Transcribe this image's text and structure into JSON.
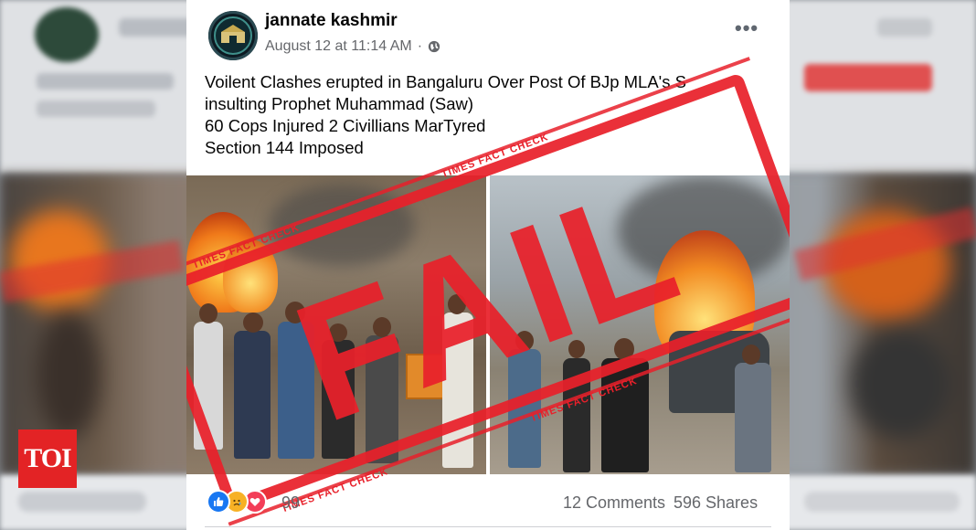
{
  "post": {
    "author": "jannate kashmir",
    "timestamp": "August 12 at 11:14 AM",
    "separator": "·",
    "more_label": "•••",
    "text_lines": [
      "Voilent Clashes erupted in Bangaluru Over Post Of BJp MLA's S",
      "insulting Prophet Muhammad (Saw)",
      "60 Cops Injured 2 Civillians MarTyred",
      "Section 144 Imposed"
    ]
  },
  "stamp": {
    "big_word": "FAIL",
    "band_text": "TIMES FACT CHECK",
    "color": "#e8202a"
  },
  "engagement": {
    "reaction_icons": [
      "like-icon",
      "sad-icon",
      "love-icon"
    ],
    "reaction_count": "99",
    "comments": "12 Comments",
    "shares": "596 Shares"
  },
  "branding": {
    "logo_text": "TOI",
    "logo_color": "#e32325"
  },
  "colors": {
    "facebook_blue": "#1877f2",
    "secondary_text": "#65676b"
  }
}
